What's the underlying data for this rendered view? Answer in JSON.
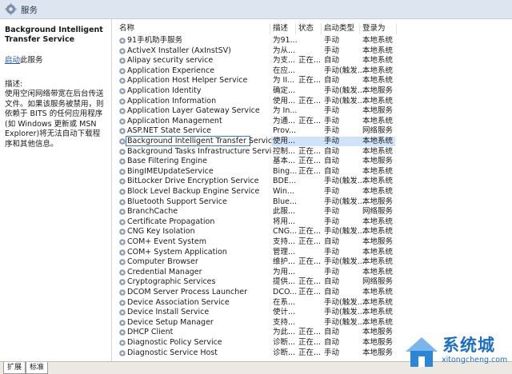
{
  "window": {
    "title": "服务"
  },
  "left": {
    "service_name": "Background Intelligent Transfer Service",
    "start_link": "启动",
    "start_suffix": "此服务",
    "desc_label": "描述:",
    "description": "使用空闲网络带宽在后台传送文件。如果该服务被禁用，则依赖于 BITS 的任何应用程序(如 Windows 更新或 MSN Explorer)将无法自动下载程序和其他信息。"
  },
  "columns": {
    "name": "名称",
    "desc": "描述",
    "status": "状态",
    "startup": "启动类型",
    "logon": "登录为"
  },
  "services": [
    {
      "name": "91手机助手服务",
      "desc": "为91...",
      "status": "",
      "startup": "手动",
      "logon": "本地系统"
    },
    {
      "name": "ActiveX Installer (AxInstSV)",
      "desc": "为从...",
      "status": "",
      "startup": "手动",
      "logon": "本地系统"
    },
    {
      "name": "Alipay security service",
      "desc": "为支...",
      "status": "正在...",
      "startup": "自动",
      "logon": "本地系统"
    },
    {
      "name": "Application Experience",
      "desc": "在应...",
      "status": "",
      "startup": "手动(触发...",
      "logon": "本地系统"
    },
    {
      "name": "Application Host Helper Service",
      "desc": "为 II...",
      "status": "正在...",
      "startup": "自动",
      "logon": "本地系统"
    },
    {
      "name": "Application Identity",
      "desc": "确定...",
      "status": "",
      "startup": "手动(触发...",
      "logon": "本地服务"
    },
    {
      "name": "Application Information",
      "desc": "使用...",
      "status": "正在...",
      "startup": "手动(触发...",
      "logon": "本地系统"
    },
    {
      "name": "Application Layer Gateway Service",
      "desc": "为 In...",
      "status": "",
      "startup": "手动",
      "logon": "本地服务"
    },
    {
      "name": "Application Management",
      "desc": "为通...",
      "status": "正在...",
      "startup": "手动",
      "logon": "本地系统"
    },
    {
      "name": "ASP.NET State Service",
      "desc": "Prov...",
      "status": "",
      "startup": "手动",
      "logon": "网络服务"
    },
    {
      "name": "Background Intelligent Transfer Service",
      "desc": "使用...",
      "status": "",
      "startup": "手动",
      "logon": "本地系统"
    },
    {
      "name": "Background Tasks Infrastructure Service",
      "desc": "控制...",
      "status": "正在...",
      "startup": "自动",
      "logon": "本地系统"
    },
    {
      "name": "Base Filtering Engine",
      "desc": "基本...",
      "status": "正在...",
      "startup": "自动",
      "logon": "本地服务"
    },
    {
      "name": "BingIMEUpdateService",
      "desc": "Bing...",
      "status": "正在...",
      "startup": "自动",
      "logon": "本地系统"
    },
    {
      "name": "BitLocker Drive Encryption Service",
      "desc": "BDE...",
      "status": "",
      "startup": "手动(触发...",
      "logon": "本地系统"
    },
    {
      "name": "Block Level Backup Engine Service",
      "desc": "Win...",
      "status": "",
      "startup": "手动",
      "logon": "本地系统"
    },
    {
      "name": "Bluetooth Support Service",
      "desc": "Blue...",
      "status": "",
      "startup": "手动(触发...",
      "logon": "本地服务"
    },
    {
      "name": "BranchCache",
      "desc": "此服...",
      "status": "",
      "startup": "手动",
      "logon": "网络服务"
    },
    {
      "name": "Certificate Propagation",
      "desc": "将用...",
      "status": "",
      "startup": "手动",
      "logon": "本地系统"
    },
    {
      "name": "CNG Key Isolation",
      "desc": "CNG...",
      "status": "正在...",
      "startup": "手动(触发...",
      "logon": "本地系统"
    },
    {
      "name": "COM+ Event System",
      "desc": "支持...",
      "status": "正在...",
      "startup": "自动",
      "logon": "本地服务"
    },
    {
      "name": "COM+ System Application",
      "desc": "管理...",
      "status": "",
      "startup": "手动",
      "logon": "本地系统"
    },
    {
      "name": "Computer Browser",
      "desc": "维护...",
      "status": "正在...",
      "startup": "手动(触发...",
      "logon": "本地系统"
    },
    {
      "name": "Credential Manager",
      "desc": "为用...",
      "status": "",
      "startup": "手动",
      "logon": "本地系统"
    },
    {
      "name": "Cryptographic Services",
      "desc": "提供...",
      "status": "正在...",
      "startup": "自动",
      "logon": "网络服务"
    },
    {
      "name": "DCOM Server Process Launcher",
      "desc": "DCO...",
      "status": "正在...",
      "startup": "自动",
      "logon": "本地系统"
    },
    {
      "name": "Device Association Service",
      "desc": "在系...",
      "status": "",
      "startup": "手动(触发...",
      "logon": "本地系统"
    },
    {
      "name": "Device Install Service",
      "desc": "使计...",
      "status": "",
      "startup": "手动(触发...",
      "logon": "本地系统"
    },
    {
      "name": "Device Setup Manager",
      "desc": "支持...",
      "status": "",
      "startup": "手动(触发...",
      "logon": "本地系统"
    },
    {
      "name": "DHCP Client",
      "desc": "为此...",
      "status": "正在...",
      "startup": "自动",
      "logon": "本地服务"
    },
    {
      "name": "Diagnostic Policy Service",
      "desc": "诊断...",
      "status": "正在...",
      "startup": "自动",
      "logon": "本地服务"
    },
    {
      "name": "Diagnostic Service Host",
      "desc": "诊断...",
      "status": "正在...",
      "startup": "手动",
      "logon": "本地服务"
    }
  ],
  "selected_index": 10,
  "tabs": {
    "extended": "扩展",
    "standard": "标准"
  },
  "watermark": {
    "brand": "系统城",
    "url": "xitongcheng.com"
  }
}
